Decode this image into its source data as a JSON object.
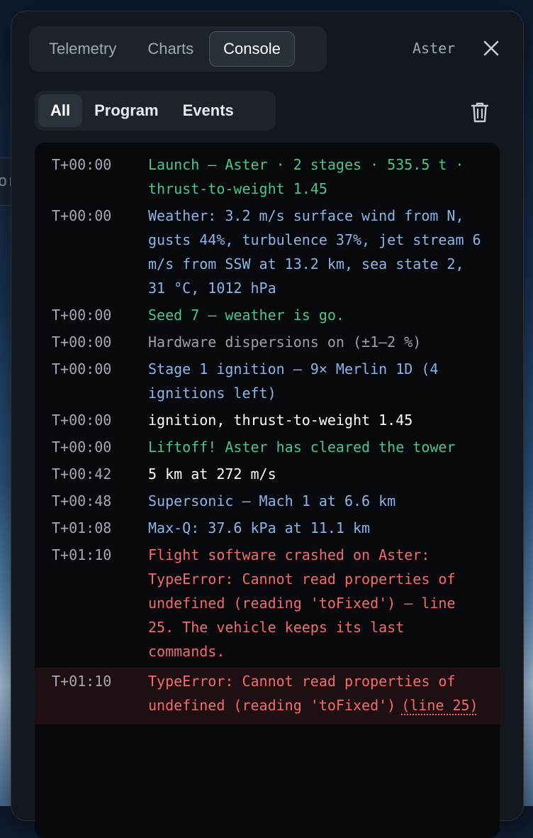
{
  "background_chip": {
    "text": "orm"
  },
  "tabs": [
    {
      "label": "Telemetry",
      "active": false
    },
    {
      "label": "Charts",
      "active": false
    },
    {
      "label": "Console",
      "active": true
    }
  ],
  "header": {
    "vehicle_name": "Aster",
    "close_icon": "close-icon"
  },
  "filters": [
    {
      "label": "All",
      "active": true
    },
    {
      "label": "Program",
      "active": false
    },
    {
      "label": "Events",
      "active": false
    }
  ],
  "trash_icon": "trash-icon",
  "colors": {
    "green": "#4ec48a",
    "blue": "#8cb5e6",
    "gray": "#9aa1ab",
    "white": "#ffffff",
    "red": "#f26c6c",
    "error_bg": "#1e1012"
  },
  "log": [
    {
      "time": "T+00:00",
      "text": "Launch — Aster · 2 stages · 535.5 t · thrust-to-weight 1.45",
      "color": "green"
    },
    {
      "time": "T+00:00",
      "text": "Weather: 3.2 m/s surface wind from N, gusts 44%, turbulence 37%, jet stream 6 m/s from SSW at 13.2 km, sea state 2, 31 °C, 1012 hPa",
      "color": "blue"
    },
    {
      "time": "T+00:00",
      "text": "Seed 7 — weather is go.",
      "color": "green"
    },
    {
      "time": "T+00:00",
      "text": "Hardware dispersions on (±1–2 %)",
      "color": "gray"
    },
    {
      "time": "T+00:00",
      "text": "Stage 1 ignition — 9× Merlin 1D (4 ignitions left)",
      "color": "blue"
    },
    {
      "time": "T+00:00",
      "text": "ignition, thrust-to-weight 1.45",
      "color": "white"
    },
    {
      "time": "T+00:00",
      "text": "Liftoff! Aster has cleared the tower",
      "color": "green"
    },
    {
      "time": "T+00:42",
      "text": "5 km at 272 m/s",
      "color": "white"
    },
    {
      "time": "T+00:48",
      "text": "Supersonic — Mach 1 at 6.6 km",
      "color": "blue"
    },
    {
      "time": "T+01:08",
      "text": "Max-Q: 37.6 kPa at 11.1 km",
      "color": "blue"
    },
    {
      "time": "T+01:10",
      "text": "Flight software crashed on Aster: TypeError: Cannot read properties of undefined (reading 'toFixed') — line 25. The vehicle keeps its last commands.",
      "color": "red"
    }
  ],
  "error_entry": {
    "time": "T+01:10",
    "text": "TypeError: Cannot read properties of undefined (reading 'toFixed')",
    "link": "(line 25)"
  }
}
